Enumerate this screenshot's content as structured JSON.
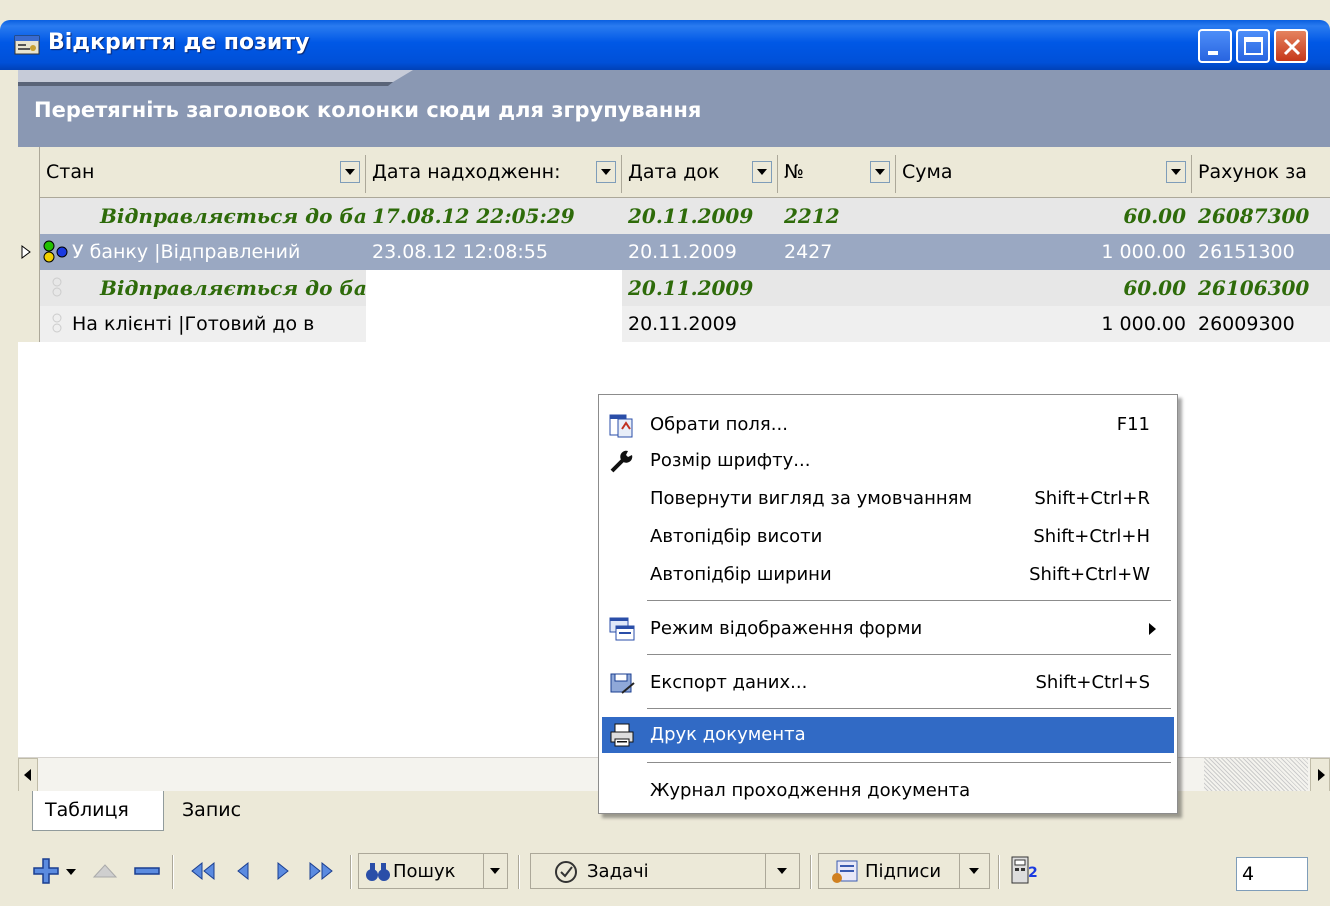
{
  "window": {
    "title": "Відкриття де позиту"
  },
  "group_panel": {
    "text": "Перетягніть заголовок колонки сюди для згрупування"
  },
  "columns": [
    {
      "label": "Стан"
    },
    {
      "label": "Дата надходженн:"
    },
    {
      "label": "Дата док"
    },
    {
      "label": "№"
    },
    {
      "label": "Сума"
    },
    {
      "label": "Рахунок за"
    }
  ],
  "rows": [
    {
      "state": "Відправляється до ба",
      "date_in": "17.08.12 22:05:29",
      "doc_date": "20.11.2009",
      "num": "2212",
      "sum": "60.00",
      "account": "26087300"
    },
    {
      "state": "У банку |Відправлений",
      "date_in": "23.08.12 12:08:55",
      "doc_date": "20.11.2009",
      "num": "2427",
      "sum": "1 000.00",
      "account": "26151300"
    },
    {
      "state": "Відправляється до ба",
      "date_in": "",
      "doc_date": "20.11.2009",
      "num": "",
      "sum": "60.00",
      "account": "26106300"
    },
    {
      "state": "На клієнті |Готовий до в",
      "date_in": "",
      "doc_date": "20.11.2009",
      "num": "",
      "sum": "1 000.00",
      "account": "26009300"
    }
  ],
  "context_menu": {
    "items": [
      {
        "label": "Обрати поля...",
        "shortcut": "F11",
        "icon": "select-fields-icon"
      },
      {
        "label": "Розмір шрифту...",
        "shortcut": "",
        "icon": "wrench-icon"
      },
      {
        "label": "Повернути вигляд за умовчанням",
        "shortcut": "Shift+Ctrl+R",
        "icon": ""
      },
      {
        "label": "Автопідбір висоти",
        "shortcut": "Shift+Ctrl+H",
        "icon": ""
      },
      {
        "label": "Автопідбір ширини",
        "shortcut": "Shift+Ctrl+W",
        "icon": ""
      },
      {
        "label": "Режим відображення форми",
        "shortcut": "",
        "icon": "form-mode-icon"
      },
      {
        "label": "Експорт даних...",
        "shortcut": "Shift+Ctrl+S",
        "icon": "export-icon"
      },
      {
        "label": "Друк документа",
        "shortcut": "",
        "icon": "printer-icon"
      },
      {
        "label": "Журнал проходження документа",
        "shortcut": "",
        "icon": ""
      }
    ]
  },
  "tabs": [
    {
      "label": "Таблиця"
    },
    {
      "label": "Запис"
    }
  ],
  "toolbar": {
    "search_label": "Пошук",
    "tasks_label": "Задачі",
    "signatures_label": "Підписи",
    "page_value": "4"
  },
  "colors": {
    "title_bar": "#0054e3",
    "group_panel": "#8a98b3",
    "selected_row": "#9aa8c2",
    "highlight": "#316ac5",
    "group_text_green": "#2e6b0a"
  }
}
